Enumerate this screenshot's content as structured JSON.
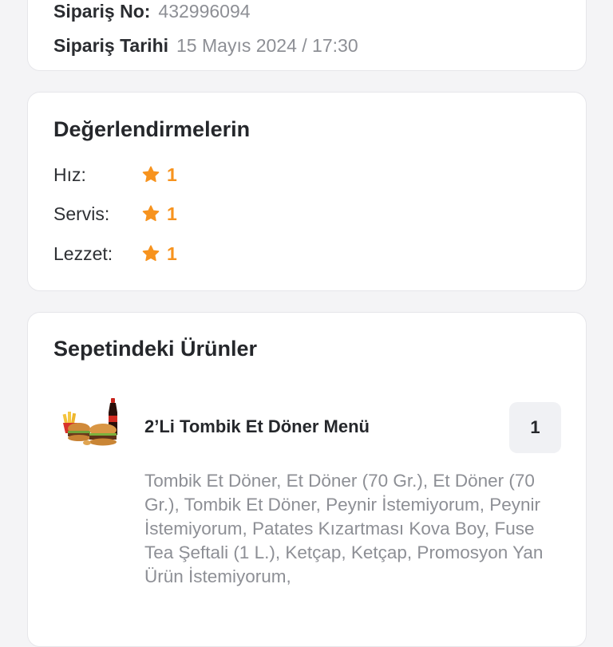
{
  "order": {
    "number_label": "Sipariş No:",
    "number_value": "432996094",
    "date_label": "Sipariş Tarihi",
    "date_value": "15 Mayıs 2024 / 17:30"
  },
  "ratings": {
    "title": "Değerlendirmelerin",
    "items": [
      {
        "label": "Hız:",
        "value": "1",
        "icon": "star-icon"
      },
      {
        "label": "Servis:",
        "value": "1",
        "icon": "star-icon"
      },
      {
        "label": "Lezzet:",
        "value": "1",
        "icon": "star-icon"
      }
    ],
    "star_color": "#f7931e"
  },
  "basket": {
    "title": "Sepetindeki Ürünler",
    "items": [
      {
        "name": "2’Li Tombik Et Döner Menü",
        "quantity": "1",
        "image": "burger-menu-image",
        "description": "Tombik Et Döner, Et Döner (70 Gr.), Et Döner (70 Gr.), Tombik Et Döner, Peynir İstemiyorum, Peynir İstemiyorum, Patates Kızartması Kova Boy, Fuse Tea Şeftali (1 L.), Ketçap, Ketçap, Promosyon Yan Ürün İstemiyorum,"
      }
    ]
  }
}
